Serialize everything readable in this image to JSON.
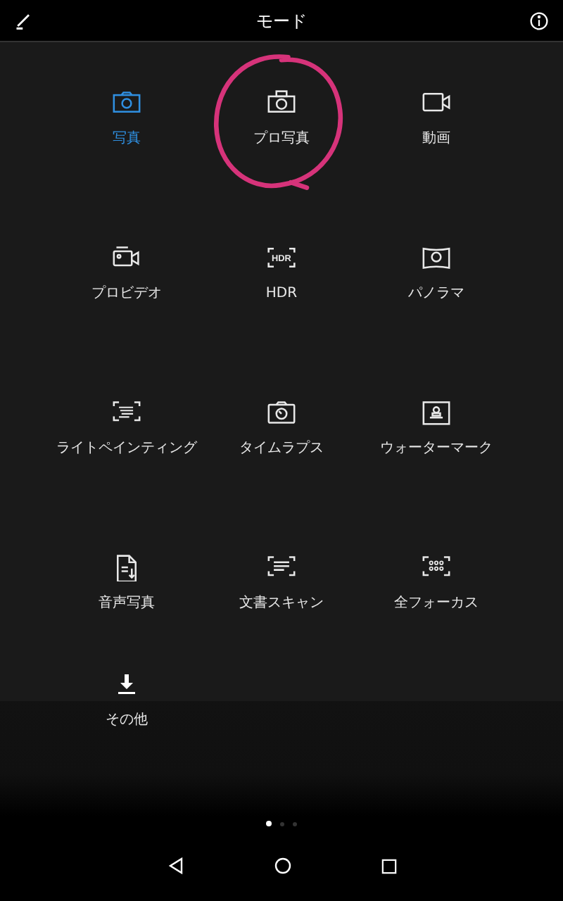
{
  "header": {
    "title": "モード"
  },
  "modes": [
    {
      "label": "写真",
      "selected": true,
      "circled": false
    },
    {
      "label": "プロ写真",
      "selected": false,
      "circled": true
    },
    {
      "label": "動画",
      "selected": false,
      "circled": false
    },
    {
      "label": "プロビデオ",
      "selected": false,
      "circled": false
    },
    {
      "label": "HDR",
      "selected": false,
      "circled": false
    },
    {
      "label": "パノラマ",
      "selected": false,
      "circled": false
    },
    {
      "label": "ライトペインティング",
      "selected": false,
      "circled": false
    },
    {
      "label": "タイムラプス",
      "selected": false,
      "circled": false
    },
    {
      "label": "ウォーターマーク",
      "selected": false,
      "circled": false
    },
    {
      "label": "音声写真",
      "selected": false,
      "circled": false
    },
    {
      "label": "文書スキャン",
      "selected": false,
      "circled": false
    },
    {
      "label": "全フォーカス",
      "selected": false,
      "circled": false
    }
  ],
  "more": {
    "label": "その他"
  },
  "pager": [
    {
      "selected": true
    },
    {
      "selected": false
    },
    {
      "selected": false
    }
  ],
  "hdr_icon_text": "HDR"
}
